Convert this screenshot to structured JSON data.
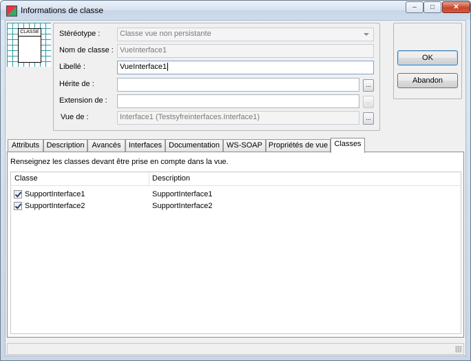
{
  "window": {
    "title": "Informations de classe",
    "close_glyph": "✕",
    "minimize_glyph": "–",
    "maximize_glyph": "□"
  },
  "class_icon": {
    "label": "CLASSE"
  },
  "form": {
    "stereotype": {
      "label": "Stéréotype :",
      "value": "Classe vue non persistante"
    },
    "class_name": {
      "label": "Nom de classe :",
      "value": "VueInterface1"
    },
    "caption": {
      "label": "Libellé :",
      "value": "VueInterface1"
    },
    "inherits": {
      "label": "Hérite de :",
      "value": ""
    },
    "extension": {
      "label": "Extension de :",
      "value": ""
    },
    "view_of": {
      "label": "Vue de :",
      "value": "Interface1 (Testsyfreinterfaces.Interface1)"
    },
    "browse_label": "..."
  },
  "buttons": {
    "ok": "OK",
    "cancel": "Abandon"
  },
  "tabs": [
    "Attributs",
    "Description",
    "Avancés",
    "Interfaces",
    "Documentation",
    "WS-SOAP",
    "Propriétés de vue",
    "Classes"
  ],
  "active_tab": "Classes",
  "classes_panel": {
    "hint": "Renseignez les classes devant être prise en compte dans la vue.",
    "columns": [
      "Classe",
      "Description"
    ],
    "rows": [
      {
        "checked": true,
        "classe": "SupportInterface1",
        "description": "SupportInterface1"
      },
      {
        "checked": true,
        "classe": "SupportInterface2",
        "description": "SupportInterface2"
      }
    ]
  }
}
